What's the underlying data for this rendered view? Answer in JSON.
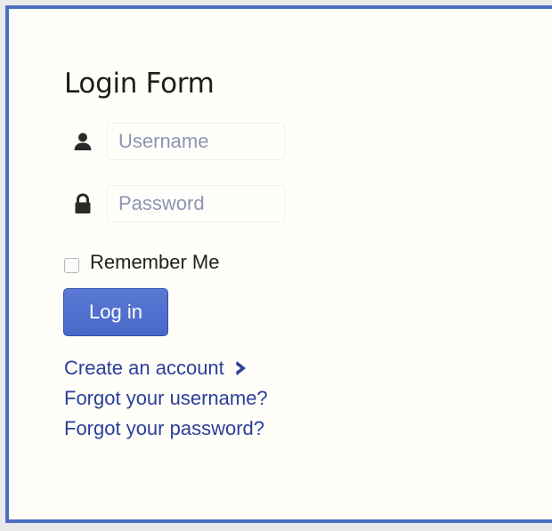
{
  "login_form": {
    "title": "Login Form",
    "username": {
      "placeholder": "Username",
      "value": "",
      "icon": "user-icon"
    },
    "password": {
      "placeholder": "Password",
      "value": "",
      "icon": "lock-icon"
    },
    "remember_me": {
      "label": "Remember Me",
      "checked": false
    },
    "login_button": {
      "label": "Log in"
    },
    "links": {
      "create_account": "Create an account",
      "create_account_icon": "chevron-right-icon",
      "forgot_username": "Forgot your username?",
      "forgot_password": "Forgot your password?"
    }
  },
  "colors": {
    "frame_border": "#4a6fc4",
    "button": "#4a69c7",
    "link": "#2b3f99",
    "background": "#fffef9"
  }
}
